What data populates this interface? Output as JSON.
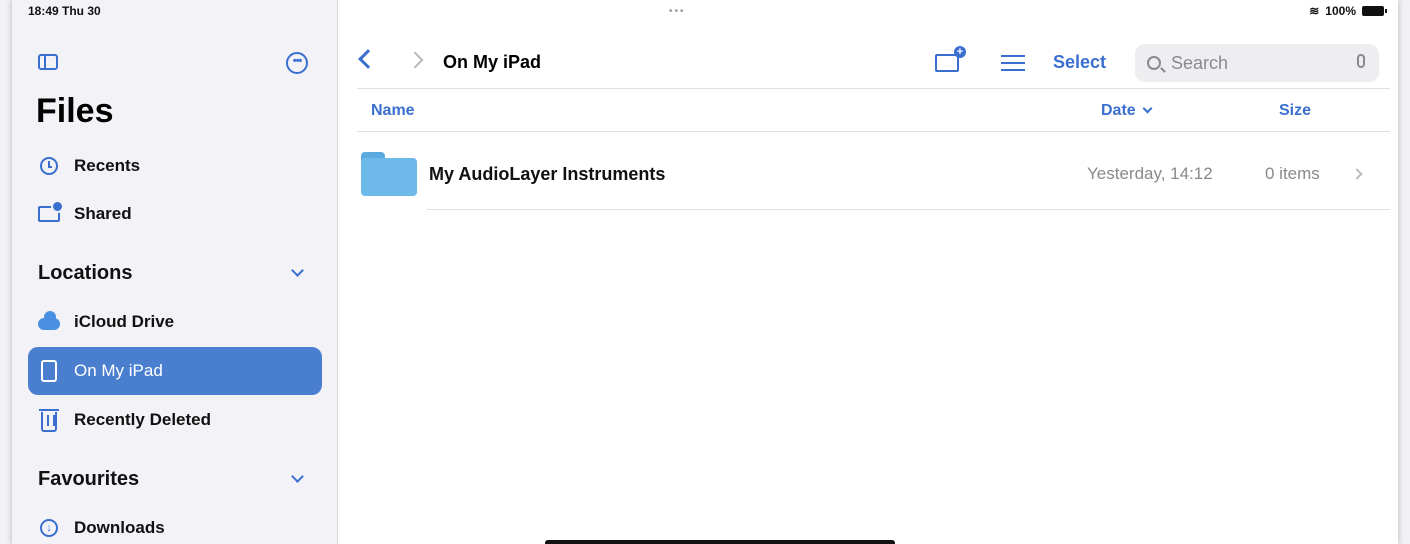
{
  "status": {
    "time": "18:49  Thu 30",
    "dots": "•••",
    "battery": "100%"
  },
  "sidebar": {
    "title": "Files",
    "top_items": [
      {
        "label": "Recents",
        "icon": "clock-icon"
      },
      {
        "label": "Shared",
        "icon": "shared-folder-icon"
      }
    ],
    "locations": {
      "heading": "Locations",
      "items": [
        {
          "label": "iCloud Drive",
          "icon": "icloud-icon"
        },
        {
          "label": "On My iPad",
          "icon": "ipad-icon",
          "selected": true
        },
        {
          "label": "Recently Deleted",
          "icon": "trash-icon"
        }
      ]
    },
    "favourites": {
      "heading": "Favourites",
      "items": [
        {
          "label": "Downloads",
          "icon": "download-icon"
        }
      ]
    }
  },
  "toolbar": {
    "title": "On My iPad",
    "select_label": "Select",
    "search_placeholder": "Search"
  },
  "columns": {
    "name": "Name",
    "date": "Date",
    "size": "Size"
  },
  "files": [
    {
      "name": "My AudioLayer Instruments",
      "date": "Yesterday, 14:12",
      "size": "0 items",
      "icon": "folder-icon"
    }
  ],
  "colors": {
    "accent": "#3a6fd0",
    "selected_bg": "#4a7fd0",
    "sidebar_bg": "#f2f2f7",
    "folder": "#6cb9ea"
  }
}
